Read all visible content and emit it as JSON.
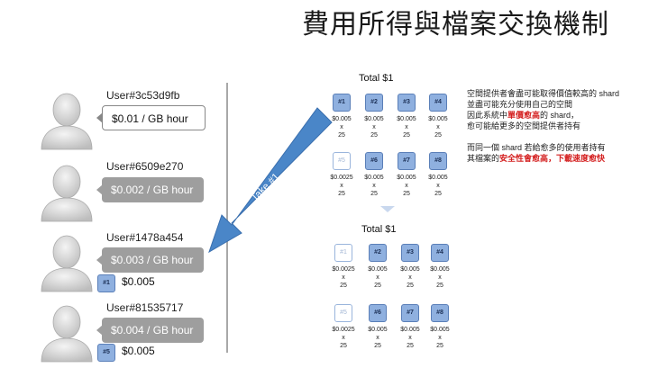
{
  "title": "費用所得與檔案交換機制",
  "users": [
    {
      "id": "User#3c53d9fb",
      "rate": "$0.01 / GB hour",
      "style": "white"
    },
    {
      "id": "User#6509e270",
      "rate": "$0.002 / GB hour",
      "style": "gray"
    },
    {
      "id": "User#1478a454",
      "rate": "$0.003 / GB hour",
      "style": "gray",
      "shard": "#1",
      "shard_price": "$0.005"
    },
    {
      "id": "User#81535717",
      "rate": "$0.004 / GB hour",
      "style": "gray",
      "shard": "#5",
      "shard_price": "$0.005"
    }
  ],
  "arrow_label": "Take #1",
  "group_top": {
    "total": "Total $1",
    "shards": [
      {
        "label": "#1",
        "price": [
          "$0.005",
          "x",
          "25"
        ],
        "empty": false
      },
      {
        "label": "#2",
        "price": [
          "$0.005",
          "x",
          "25"
        ],
        "empty": false
      },
      {
        "label": "#3",
        "price": [
          "$0.005",
          "x",
          "25"
        ],
        "empty": false
      },
      {
        "label": "#4",
        "price": [
          "$0.005",
          "x",
          "25"
        ],
        "empty": false
      },
      {
        "label": "#5",
        "price": [
          "$0.0025",
          "x",
          "25"
        ],
        "empty": true
      },
      {
        "label": "#6",
        "price": [
          "$0.005",
          "x",
          "25"
        ],
        "empty": false
      },
      {
        "label": "#7",
        "price": [
          "$0.005",
          "x",
          "25"
        ],
        "empty": false
      },
      {
        "label": "#8",
        "price": [
          "$0.005",
          "x",
          "25"
        ],
        "empty": false
      }
    ]
  },
  "group_bottom": {
    "total": "Total $1",
    "shards": [
      {
        "label": "#1",
        "price": [
          "$0.0025",
          "x",
          "25"
        ],
        "empty": true
      },
      {
        "label": "#2",
        "price": [
          "$0.005",
          "x",
          "25"
        ],
        "empty": false
      },
      {
        "label": "#3",
        "price": [
          "$0.005",
          "x",
          "25"
        ],
        "empty": false
      },
      {
        "label": "#4",
        "price": [
          "$0.005",
          "x",
          "25"
        ],
        "empty": false
      },
      {
        "label": "#5",
        "price": [
          "$0.0025",
          "x",
          "25"
        ],
        "empty": true
      },
      {
        "label": "#6",
        "price": [
          "$0.005",
          "x",
          "25"
        ],
        "empty": false
      },
      {
        "label": "#7",
        "price": [
          "$0.005",
          "x",
          "25"
        ],
        "empty": false
      },
      {
        "label": "#8",
        "price": [
          "$0.005",
          "x",
          "25"
        ],
        "empty": false
      }
    ]
  },
  "notes": {
    "para1_line1": "空間提供者會盡可能取得價值較高的 shard",
    "para1_line2": "並盡可能充分使用自己的空間",
    "para1_line3_a": "因此系統中",
    "para1_line3_red": "單價愈高",
    "para1_line3_b": "的 shard，",
    "para1_line4": "愈可能給更多的空間提供者持有",
    "para2_line1": "而同一個 shard 若給愈多的使用者持有",
    "para2_line2_a": "其檔案的",
    "para2_line2_red": "安全性會愈高，下載速度愈快"
  },
  "colors": {
    "shard_fill": "#8fb0df",
    "arrow": "#4a86c8",
    "highlight": "#d42020",
    "gray_bubble": "#9e9e9e"
  }
}
